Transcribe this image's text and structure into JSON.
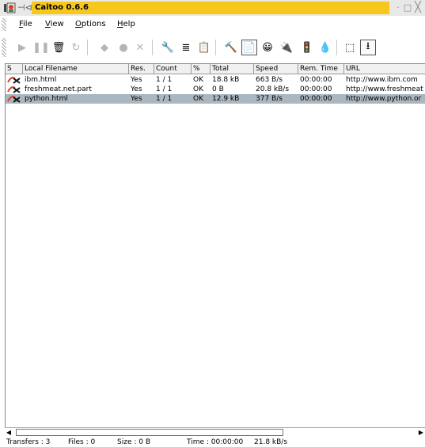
{
  "window": {
    "title": "Caitoo 0.6.6",
    "pin_glyph": "⊣⊲",
    "min_glyph": "·",
    "max_glyph": "□",
    "close_glyph": "╳"
  },
  "menu": [
    {
      "label": "File",
      "accel": "F"
    },
    {
      "label": "View",
      "accel": "V"
    },
    {
      "label": "Options",
      "accel": "O"
    },
    {
      "label": "Help",
      "accel": "H"
    }
  ],
  "toolbar_icons": [
    {
      "name": "play-icon",
      "glyph": "▶",
      "disabled": true
    },
    {
      "name": "pause-icon",
      "glyph": "❚❚",
      "disabled": true
    },
    {
      "name": "delete-icon",
      "glyph": "🗑",
      "disabled": false
    },
    {
      "name": "restart-icon",
      "glyph": "↻",
      "disabled": true
    },
    {
      "name": "queue-icon",
      "glyph": "◆",
      "disabled": true
    },
    {
      "name": "record-icon",
      "glyph": "●",
      "disabled": true
    },
    {
      "name": "cancel-icon",
      "glyph": "✕",
      "disabled": true
    },
    {
      "name": "settings-icon",
      "glyph": "🔧",
      "disabled": false
    },
    {
      "name": "log-icon",
      "glyph": "≣",
      "disabled": false
    },
    {
      "name": "paste-icon",
      "glyph": "📋",
      "disabled": false
    },
    {
      "name": "expert-icon",
      "glyph": "🔨",
      "disabled": false
    },
    {
      "name": "docked-icon",
      "glyph": "📄",
      "disabled": false,
      "pressed": true
    },
    {
      "name": "animated-icon",
      "glyph": "😀",
      "disabled": false
    },
    {
      "name": "offline-icon",
      "glyph": "🔌",
      "disabled": false
    },
    {
      "name": "traffic-icon",
      "glyph": "🚦",
      "disabled": false
    },
    {
      "name": "drop-icon",
      "glyph": "💧",
      "disabled": false
    },
    {
      "name": "dropzone-icon",
      "glyph": "⬚",
      "disabled": false
    },
    {
      "name": "download-icon",
      "glyph": "⭳",
      "disabled": false,
      "pressed": true
    }
  ],
  "columns": [
    "S",
    "Local Filename",
    "Res.",
    "Count",
    "%",
    "Total",
    "Speed",
    "Rem. Time",
    "URL"
  ],
  "rows": [
    {
      "filename": "ibm.html",
      "res": "Yes",
      "count": "1 / 1",
      "pct": "OK",
      "total": "18.8 kB",
      "speed": "663 B/s",
      "remtime": "00:00:00",
      "url": "http://www.ibm.com",
      "selected": false
    },
    {
      "filename": "freshmeat.net.part",
      "res": "Yes",
      "count": "1 / 1",
      "pct": "OK",
      "total": "0 B",
      "speed": "20.8 kB/s",
      "remtime": "00:00:00",
      "url": "http://www.freshmeat",
      "selected": false
    },
    {
      "filename": "python.html",
      "res": "Yes",
      "count": "1 / 1",
      "pct": "OK",
      "total": "12.9 kB",
      "speed": "377 B/s",
      "remtime": "00:00:00",
      "url": "http://www.python.or",
      "selected": true
    }
  ],
  "status": {
    "transfers": "Transfers : 3",
    "files": "Files : 0",
    "size": "Size : 0 B",
    "time": "Time : 00:00:00",
    "speed": "21.8 kB/s"
  },
  "colors": {
    "title_highlight": "#f7c81c",
    "selected_row": "#aab6c0"
  }
}
